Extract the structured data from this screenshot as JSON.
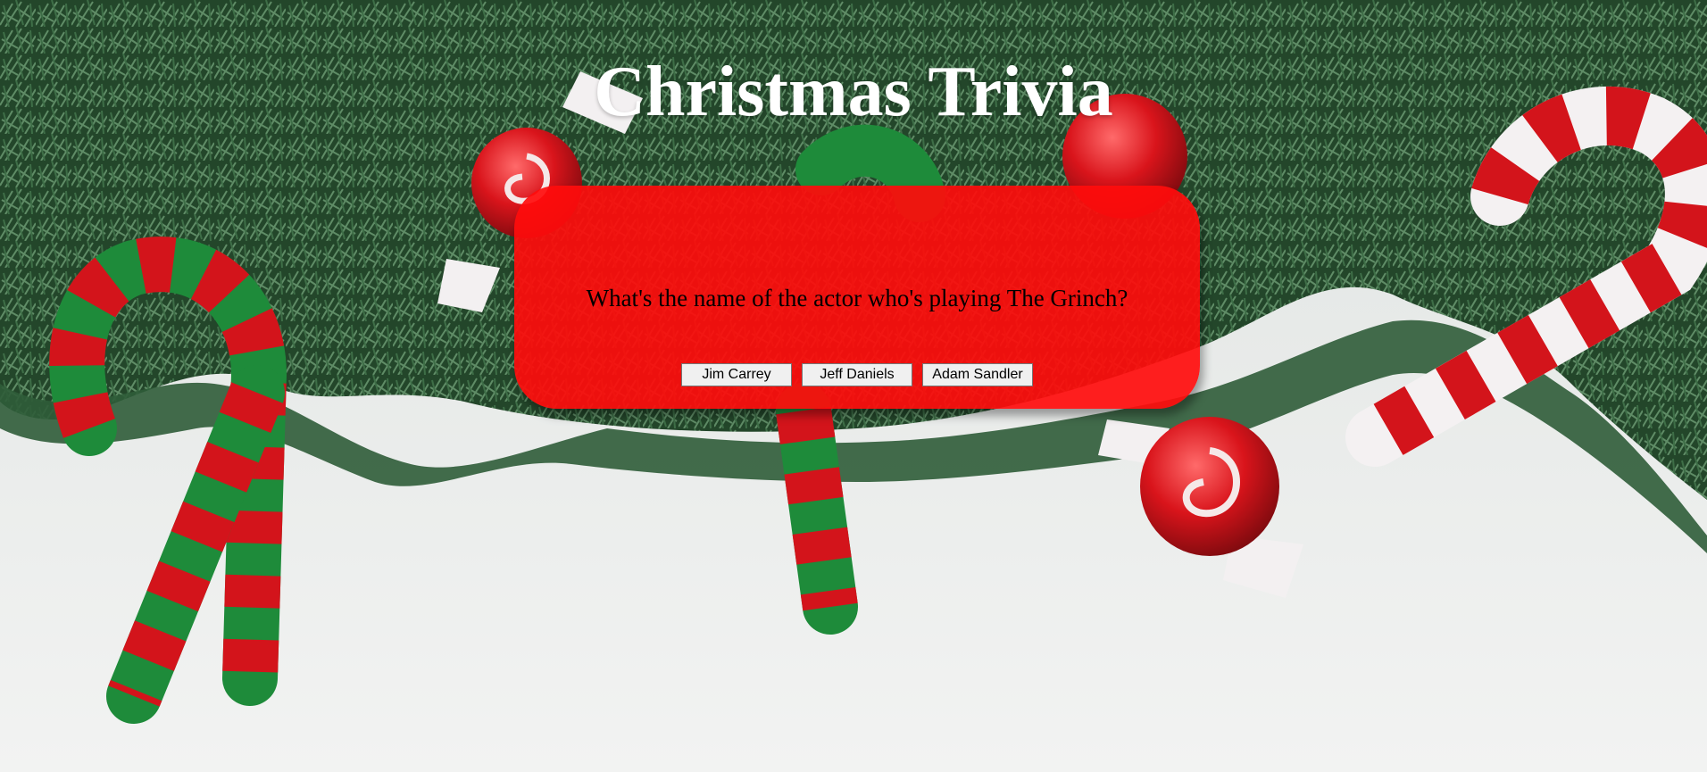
{
  "page": {
    "title": "Christmas Trivia"
  },
  "quiz": {
    "question": "What's the name of the actor who's playing The Grinch?",
    "answers": [
      "Jim Carrey",
      "Jeff Daniels",
      "Adam Sandler"
    ]
  },
  "colors": {
    "card": "#ff0c0c",
    "title_text": "#ffffff",
    "background": "#e9ecea",
    "garland": "#2d5a34",
    "ornament_red": "#d9141b",
    "glitter_green": "#1f8a3a"
  },
  "background_image": {
    "description_icon": "christmas-garland-candy-cane-background"
  }
}
